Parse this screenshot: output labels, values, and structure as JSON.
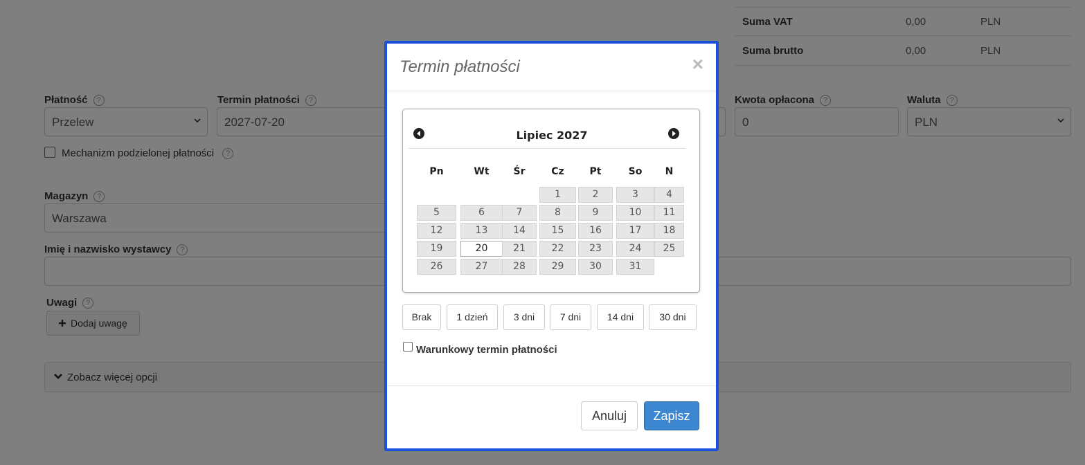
{
  "totals": [
    {
      "label": "Suma VAT",
      "value": "0,00",
      "currency": "PLN"
    },
    {
      "label": "Suma brutto",
      "value": "0,00",
      "currency": "PLN"
    }
  ],
  "form": {
    "payment": {
      "label": "Płatność",
      "value": "Przelew"
    },
    "due_date": {
      "label": "Termin płatności",
      "value": "2027-07-20"
    },
    "paid_amount": {
      "label": "Kwota opłacona",
      "value": "0"
    },
    "currency": {
      "label": "Waluta",
      "value": "PLN"
    },
    "split_payment_label": "Mechanizm podzielonej płatności",
    "warehouse": {
      "label": "Magazyn",
      "value": "Warszawa"
    },
    "issuer": {
      "label": "Imię i nazwisko wystawcy",
      "value": ""
    },
    "notes": {
      "label": "Uwagi",
      "add_button": "Dodaj uwagę"
    },
    "more_options": "Zobacz więcej opcji",
    "help_glyph": "?"
  },
  "modal": {
    "title": "Termin płatności",
    "close_glyph": "×",
    "calendar": {
      "month_title": "Lipiec 2027",
      "weekdays": [
        "Pn",
        "Wt",
        "Śr",
        "Cz",
        "Pt",
        "So",
        "N"
      ],
      "weeks": [
        [
          "",
          "",
          "",
          "1",
          "2",
          "3",
          "4"
        ],
        [
          "5",
          "6",
          "7",
          "8",
          "9",
          "10",
          "11"
        ],
        [
          "12",
          "13",
          "14",
          "15",
          "16",
          "17",
          "18"
        ],
        [
          "19",
          "20",
          "21",
          "22",
          "23",
          "24",
          "25"
        ],
        [
          "26",
          "27",
          "28",
          "29",
          "30",
          "31",
          ""
        ]
      ],
      "selected_day": "20"
    },
    "quick_buttons": [
      "Brak",
      "1 dzień",
      "3 dni",
      "7 dni",
      "14 dni",
      "30 dni"
    ],
    "conditional_label": "Warunkowy termin płatności",
    "cancel_label": "Anuluj",
    "save_label": "Zapisz"
  },
  "colors": {
    "modal_border": "#1a4fdb",
    "primary_button": "#3d87d0",
    "backdrop": "rgba(0,0,0,0.5)"
  }
}
